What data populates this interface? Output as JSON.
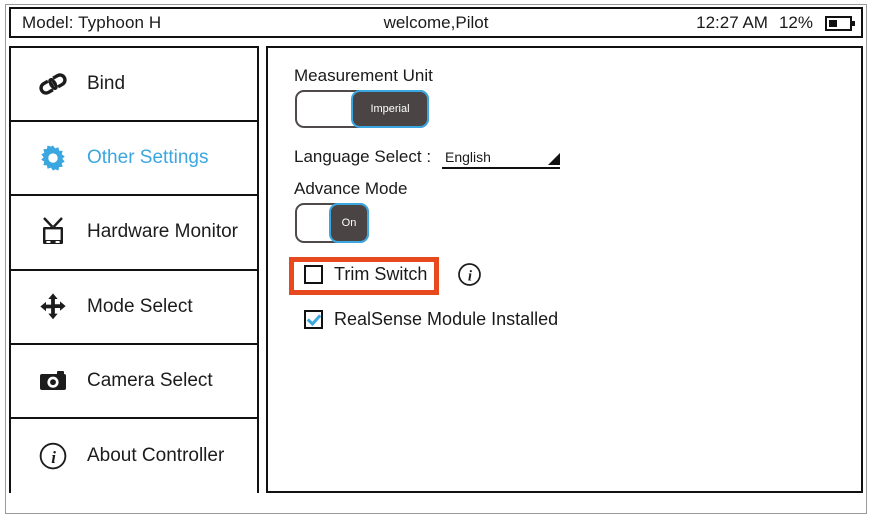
{
  "header": {
    "model_label": "Model: Typhoon H",
    "welcome": "welcome,Pilot",
    "time": "12:27 AM",
    "battery_percent": "12%",
    "battery_icon": "battery-icon"
  },
  "sidebar": {
    "items": [
      {
        "label": "Bind",
        "icon": "link-icon",
        "active": false
      },
      {
        "label": "Other Settings",
        "icon": "gear-icon",
        "active": true
      },
      {
        "label": "Hardware Monitor",
        "icon": "tv-icon",
        "active": false
      },
      {
        "label": "Mode Select",
        "icon": "four-arrows-icon",
        "active": false
      },
      {
        "label": "Camera Select",
        "icon": "camera-icon",
        "active": false
      },
      {
        "label": "About Controller",
        "icon": "info-icon",
        "active": false
      }
    ]
  },
  "main": {
    "measurement_unit": {
      "label": "Measurement Unit",
      "value": "Imperial",
      "state": "on"
    },
    "language_select": {
      "label": "Language Select :",
      "value": "English"
    },
    "advance_mode": {
      "label": "Advance Mode",
      "value": "On",
      "state": "on"
    },
    "trim_switch": {
      "label": "Trim Switch",
      "checked": false,
      "info_icon": "info-icon",
      "highlighted": true
    },
    "realsense": {
      "label": "RealSense Module Installed",
      "checked": true
    }
  },
  "colors": {
    "accent_blue": "#3ba7e0",
    "highlight_red": "#e8481e",
    "knob_gray": "#4a4544",
    "border_black": "#111111"
  }
}
